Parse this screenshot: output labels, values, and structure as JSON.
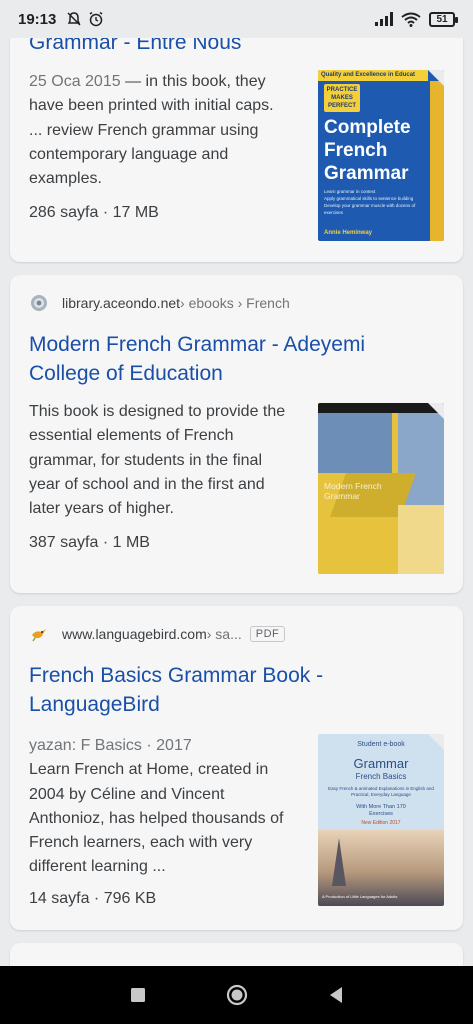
{
  "status_bar": {
    "time": "19:13",
    "battery": "51"
  },
  "results": [
    {
      "title": "Grammar - Entre Nous",
      "date": "25 Oca 2015",
      "snippet": " — in this book, they have been printed with initial caps. ... review French grammar using contemporary language and examples.",
      "meta": "286 sayfa · 17 MB",
      "cover": {
        "banner": "Quality and Excellence in Educat",
        "badge": "PRACTICE MAKES PERFECT",
        "line1": "Complete",
        "line2": "French",
        "line3": "Grammar",
        "author": "Annie Heminway",
        "bullets": [
          "Learn grammar in context",
          "Apply grammatical skills to sentence building",
          "Develop your grammar muscle with dozens of exercises"
        ],
        "colors": {
          "bg": "#1e5bb0",
          "banner": "#f3d03b",
          "edge": "#e7b52d"
        }
      }
    },
    {
      "domain": "library.aceondo.net",
      "path": " › ebooks › French",
      "title": "Modern French Grammar - Adeyemi College of Education",
      "snippet": "This book is designed to provide the essential elements of French grammar, for students in the final year of school and in the first and later years of higher.",
      "meta": "387 sayfa · 1 MB",
      "cover": {
        "title": "Modern French Grammar",
        "colors": {
          "yellow": "#e6c23d",
          "blue": "#6d8fb7",
          "dark": "#1a1a1a"
        }
      }
    },
    {
      "domain": "www.languagebird.com",
      "path": " › sa...",
      "badge": "PDF",
      "title": "French Basics Grammar Book - LanguageBird",
      "byline": "yazan: F Basics · 2017",
      "snippet": "Learn French at Home, created in 2004 by Céline and Vincent Anthonioz, has helped thousands of French learners, each with very different learning ...",
      "meta": "14 sayfa · 796 KB",
      "cover": {
        "top": "Student e-book",
        "title": "Grammar",
        "subtitle": "French Basics",
        "desc": "Easy French & animated Explanations in English and Practical, Everyday Language",
        "exercises": "With More Than 170 Exercises",
        "edition": "New Edition 2017",
        "publisher": "A Production of Little Languages for Adults",
        "colors": {
          "bg": "#cfe0ee",
          "title": "#2c4f86",
          "sky": "#e8d3b8"
        }
      }
    }
  ],
  "accent": "#1a4fa8"
}
